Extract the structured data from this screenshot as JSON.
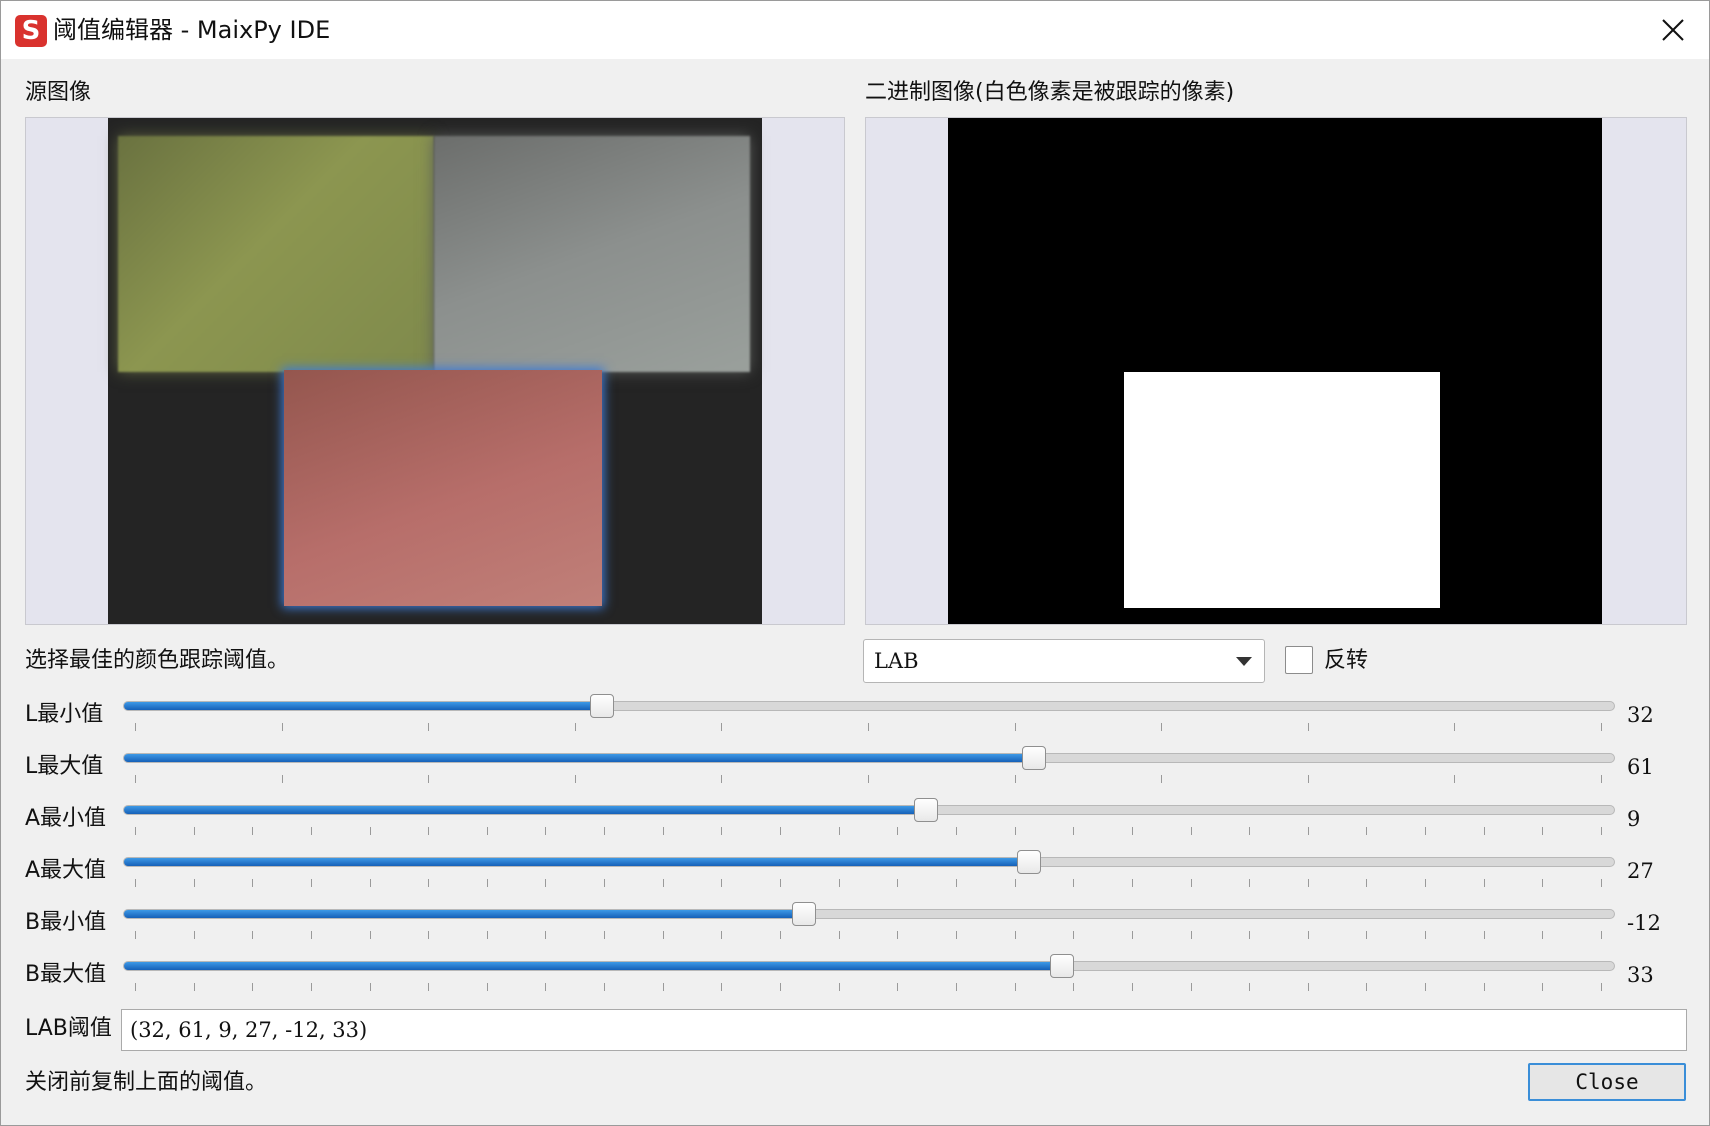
{
  "window": {
    "title": "阈值编辑器 - MaixPy IDE",
    "app_icon_glyph": "S",
    "app_icon_color": "#d9322e"
  },
  "source_panel": {
    "label": "源图像"
  },
  "binary_panel": {
    "label": "二进制图像(白色像素是被跟踪的像素)"
  },
  "instructions": "选择最佳的颜色跟踪阈值。",
  "color_space": {
    "selected": "LAB"
  },
  "invert": {
    "label": "反转",
    "checked": false
  },
  "sliders": [
    {
      "label": "L最小值",
      "value": "32",
      "fraction": 0.32,
      "ticks": 11
    },
    {
      "label": "L最大值",
      "value": "61",
      "fraction": 0.61,
      "ticks": 11
    },
    {
      "label": "A最小值",
      "value": "9",
      "fraction": 0.5375,
      "ticks": 26
    },
    {
      "label": "A最大值",
      "value": "27",
      "fraction": 0.607,
      "ticks": 26
    },
    {
      "label": "B最小值",
      "value": "-12",
      "fraction": 0.456,
      "ticks": 26
    },
    {
      "label": "B最大值",
      "value": "33",
      "fraction": 0.629,
      "ticks": 26
    }
  ],
  "threshold": {
    "label": "LAB阈值",
    "value": "(32, 61, 9, 27, -12, 33)"
  },
  "footer": {
    "note": "关闭前复制上面的阈值。",
    "close_label": "Close"
  },
  "colors": {
    "accent": "#1f78d1",
    "slider_fill": "#2a7fd6",
    "focus_border": "#3a8ed8"
  }
}
